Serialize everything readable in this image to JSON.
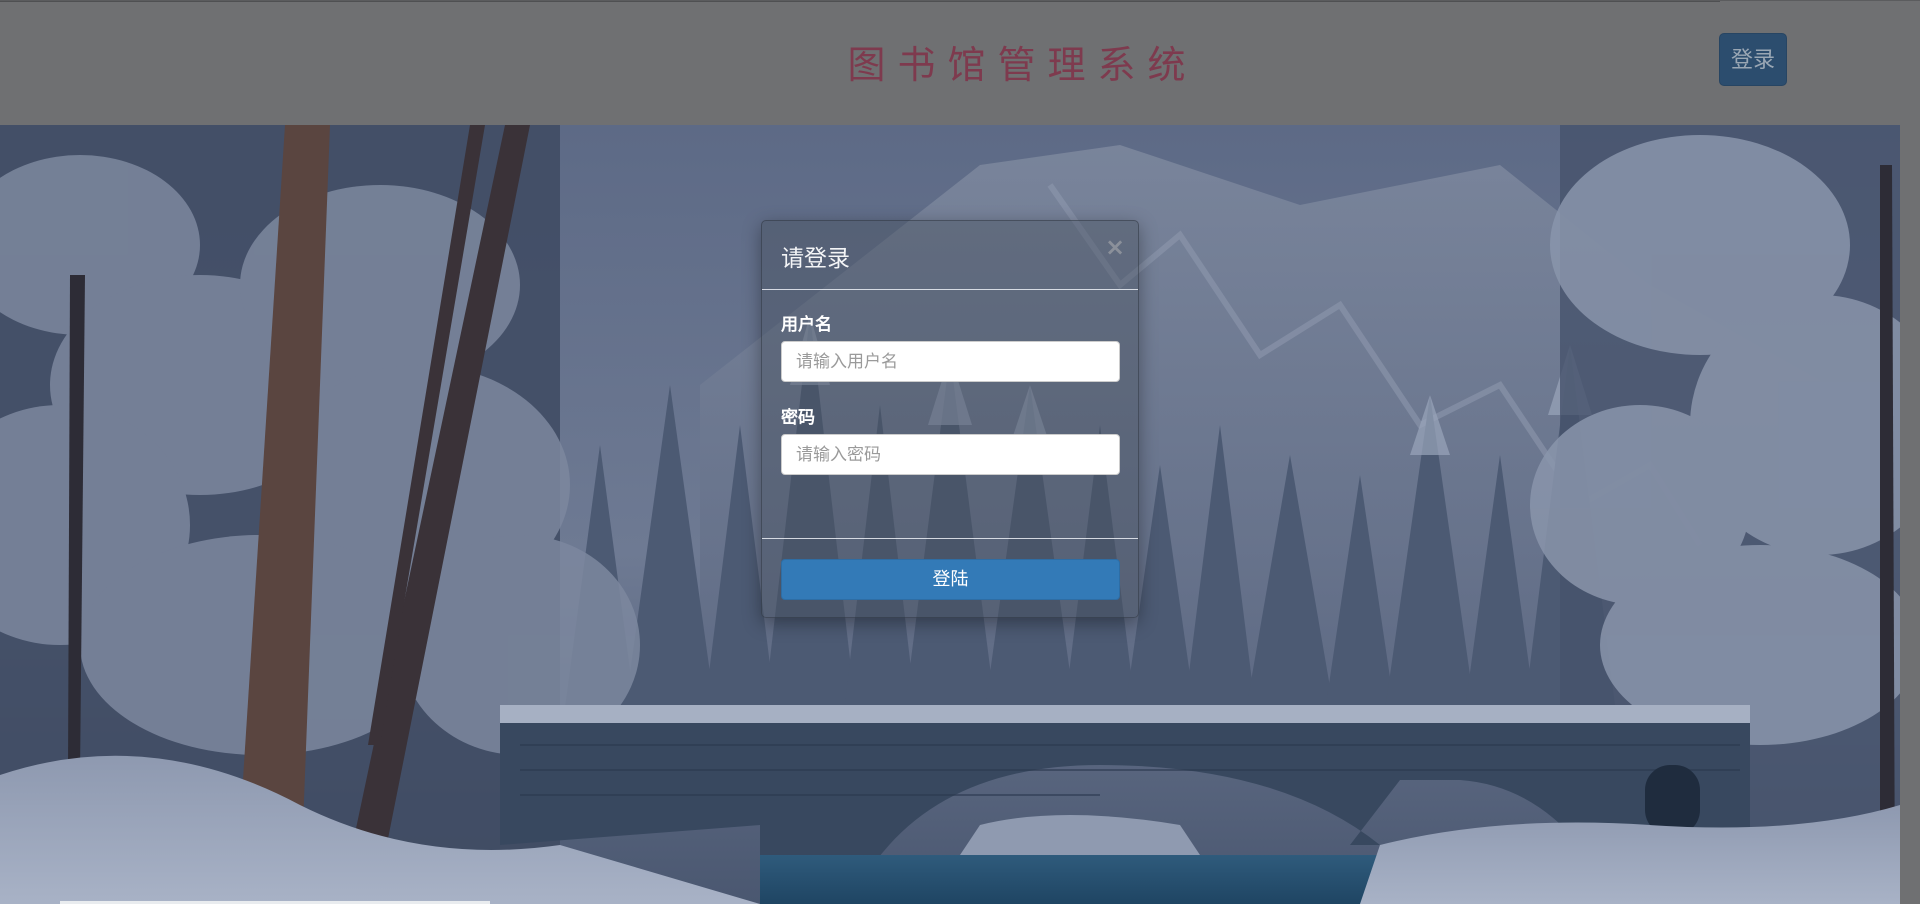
{
  "header": {
    "title": "图书馆管理系统",
    "login_button": "登录"
  },
  "modal": {
    "title": "请登录",
    "close_symbol": "×",
    "username": {
      "label": "用户名",
      "placeholder": "请输入用户名",
      "value": ""
    },
    "password": {
      "label": "密码",
      "placeholder": "请输入密码",
      "value": ""
    },
    "submit_label": "登陆"
  },
  "colors": {
    "header_bg": "#6f7072",
    "title_color": "#7e3a4e",
    "primary_button": "#337ab7"
  },
  "background": {
    "scene": "snowy-forest-stone-bridge"
  }
}
